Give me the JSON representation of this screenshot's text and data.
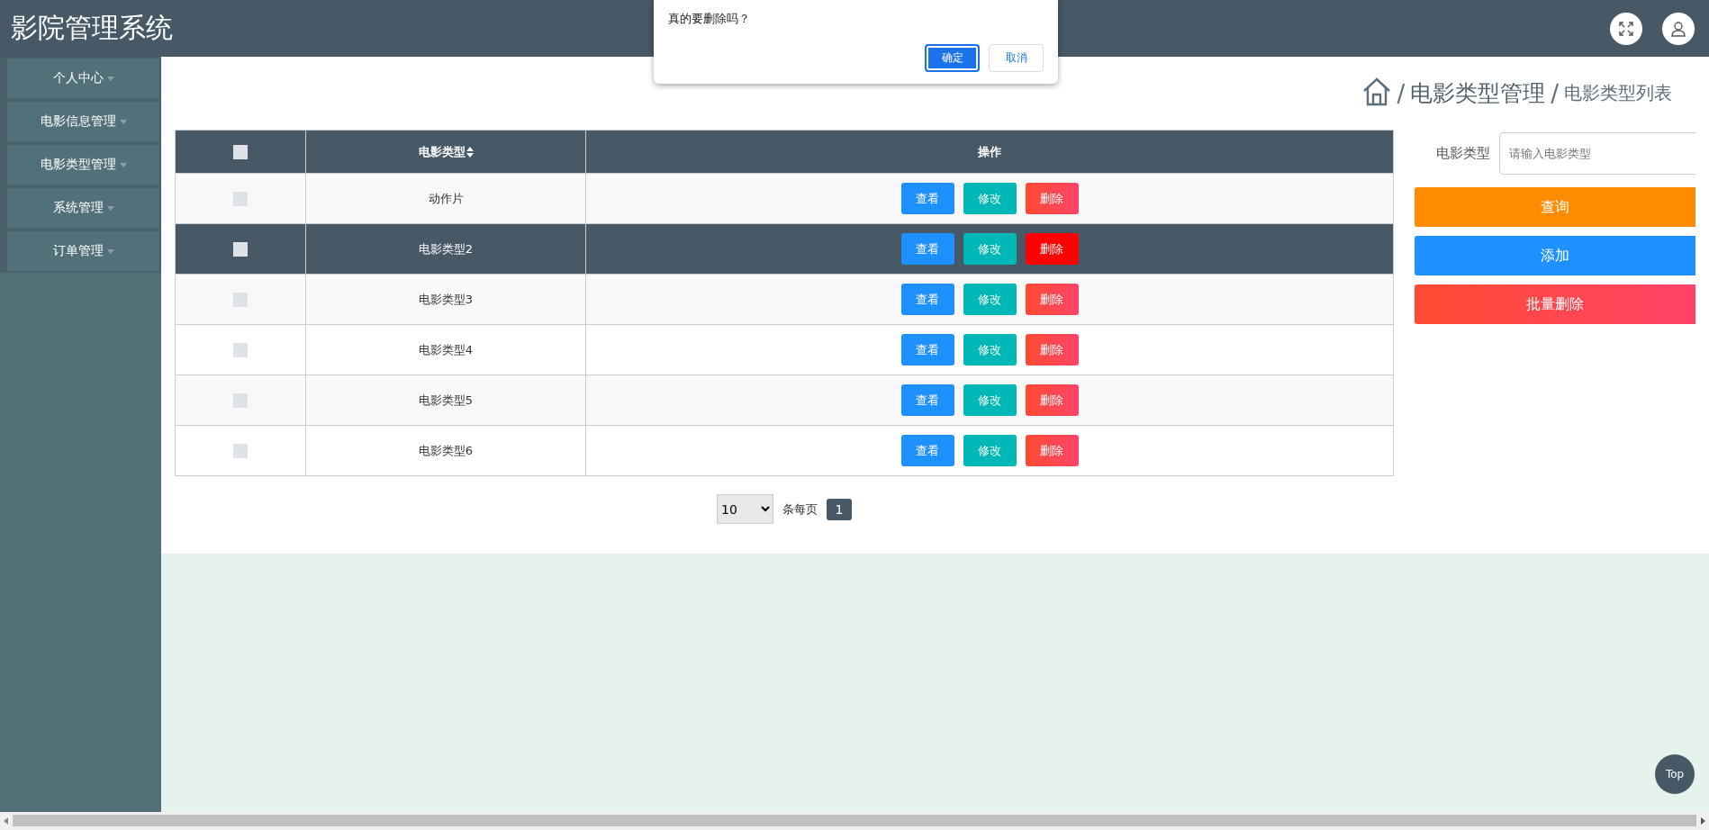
{
  "header": {
    "title": "影院管理系统"
  },
  "sidebar": {
    "items": [
      {
        "label": "个人中心"
      },
      {
        "label": "电影信息管理"
      },
      {
        "label": "电影类型管理"
      },
      {
        "label": "系统管理"
      },
      {
        "label": "订单管理"
      }
    ]
  },
  "breadcrumb": {
    "separators": [
      "/",
      "/"
    ],
    "section": "电影类型管理",
    "page": "电影类型列表"
  },
  "table": {
    "header_checkbox": {
      "checked": false
    },
    "columns": [
      "电影类型",
      "操作"
    ],
    "rows": [
      {
        "checked": false,
        "highlighted": false,
        "type": "动作片",
        "actions": [
          "查看",
          "修改",
          "删除"
        ]
      },
      {
        "checked": false,
        "highlighted": true,
        "type": "电影类型2",
        "actions": [
          "查看",
          "修改",
          "删除"
        ]
      },
      {
        "checked": false,
        "highlighted": false,
        "type": "电影类型3",
        "actions": [
          "查看",
          "修改",
          "删除"
        ]
      },
      {
        "checked": false,
        "highlighted": false,
        "type": "电影类型4",
        "actions": [
          "查看",
          "修改",
          "删除"
        ]
      },
      {
        "checked": false,
        "highlighted": false,
        "type": "电影类型5",
        "actions": [
          "查看",
          "修改",
          "删除"
        ]
      },
      {
        "checked": false,
        "highlighted": false,
        "type": "电影类型6",
        "actions": [
          "查看",
          "修改",
          "删除"
        ]
      }
    ]
  },
  "pagination": {
    "page_size": "10",
    "page_size_label": "条每页",
    "pages": [
      {
        "label": "1",
        "selected": true
      }
    ]
  },
  "search_panel": {
    "label": "电影类型",
    "placeholder": "请输入电影类型",
    "buttons": [
      {
        "kind": "query",
        "label": "查询"
      },
      {
        "kind": "add",
        "label": "添加"
      },
      {
        "kind": "batch_delete",
        "label": "批量删除"
      }
    ]
  },
  "dialog": {
    "message": "真的要删除吗？",
    "buttons": [
      {
        "kind": "confirm",
        "label": "确定"
      },
      {
        "kind": "cancel",
        "label": "取消"
      }
    ]
  },
  "back_to_top": "Top"
}
